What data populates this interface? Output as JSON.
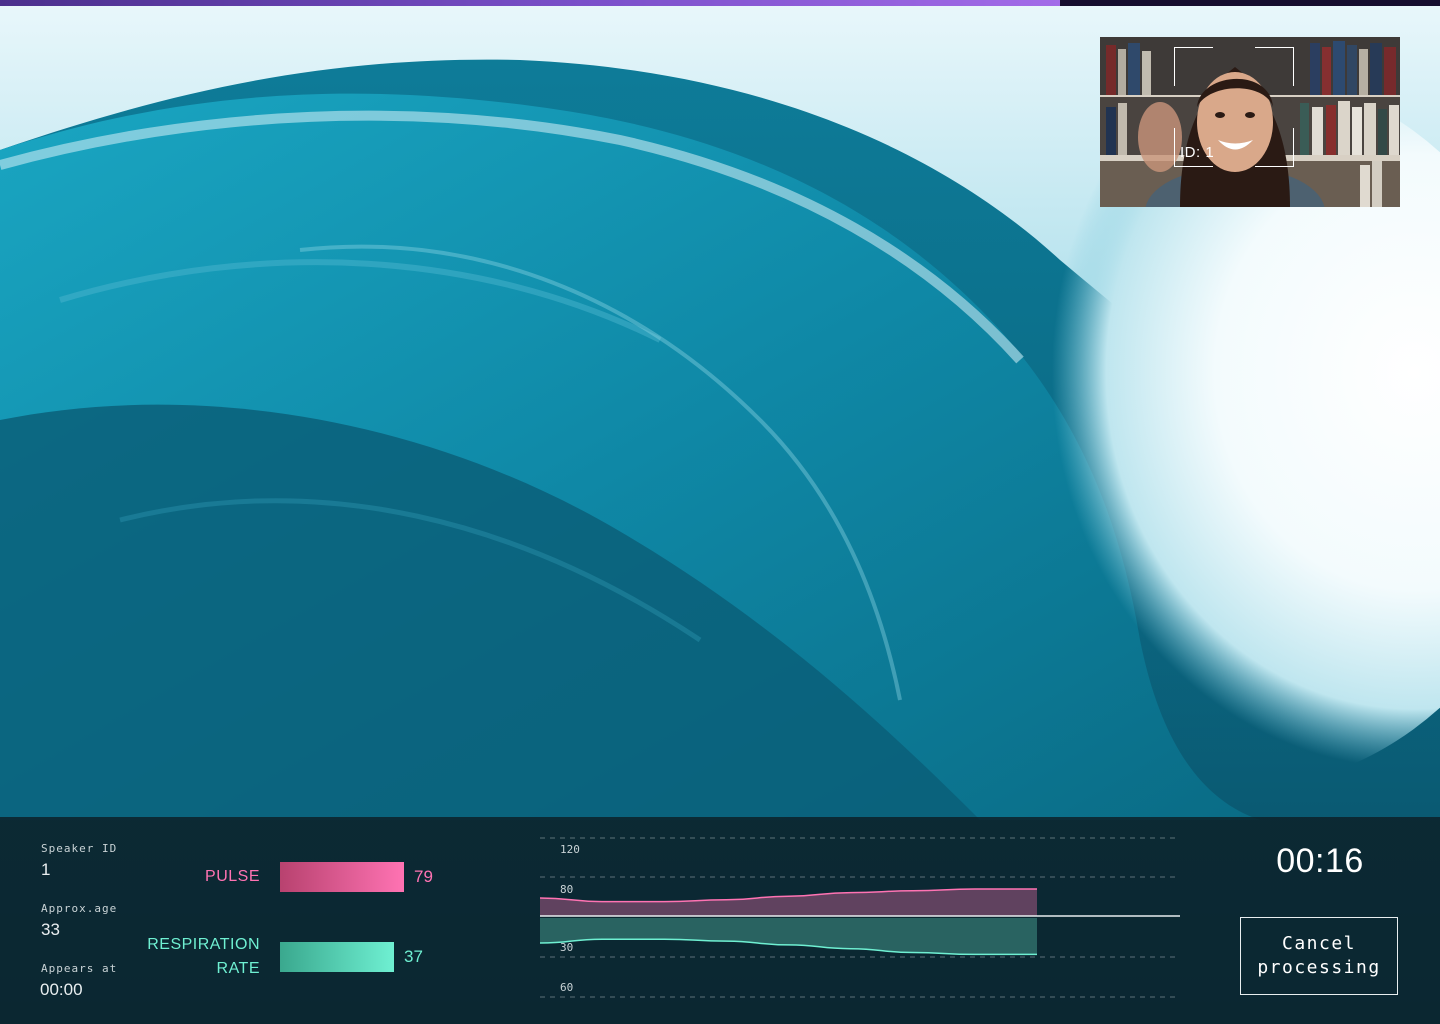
{
  "progress": {
    "value_fraction": 0.736
  },
  "webcam": {
    "face_label": "ID: 1"
  },
  "speaker": {
    "id_label": "Speaker ID",
    "id_value": "1",
    "age_label": "Approx.age",
    "age_value": "33",
    "appears_label": "Appears at",
    "appears_value": "00:00"
  },
  "metrics": {
    "pulse": {
      "label": "PULSE",
      "value": "79",
      "color": "#ff73b3"
    },
    "respiration": {
      "label_line1": "RESPIRATION",
      "label_line2": "RATE",
      "value": "37",
      "color": "#6ff0d2"
    }
  },
  "chart_data": {
    "type": "area",
    "tick_labels_upper": [
      "120",
      "80"
    ],
    "tick_labels_lower": [
      "30",
      "60"
    ],
    "series": [
      {
        "name": "PULSE",
        "color": "#ff73b3",
        "values": [
          80,
          78,
          78,
          79,
          81,
          83,
          84,
          85,
          85
        ]
      },
      {
        "name": "RESPIRATION RATE",
        "color": "#6ff0d2",
        "values": [
          30,
          32,
          32,
          31,
          29,
          27,
          25,
          24,
          24
        ]
      }
    ],
    "grid": true
  },
  "timer": "00:16",
  "cancel_button": {
    "label": "Cancel\nprocessing"
  }
}
